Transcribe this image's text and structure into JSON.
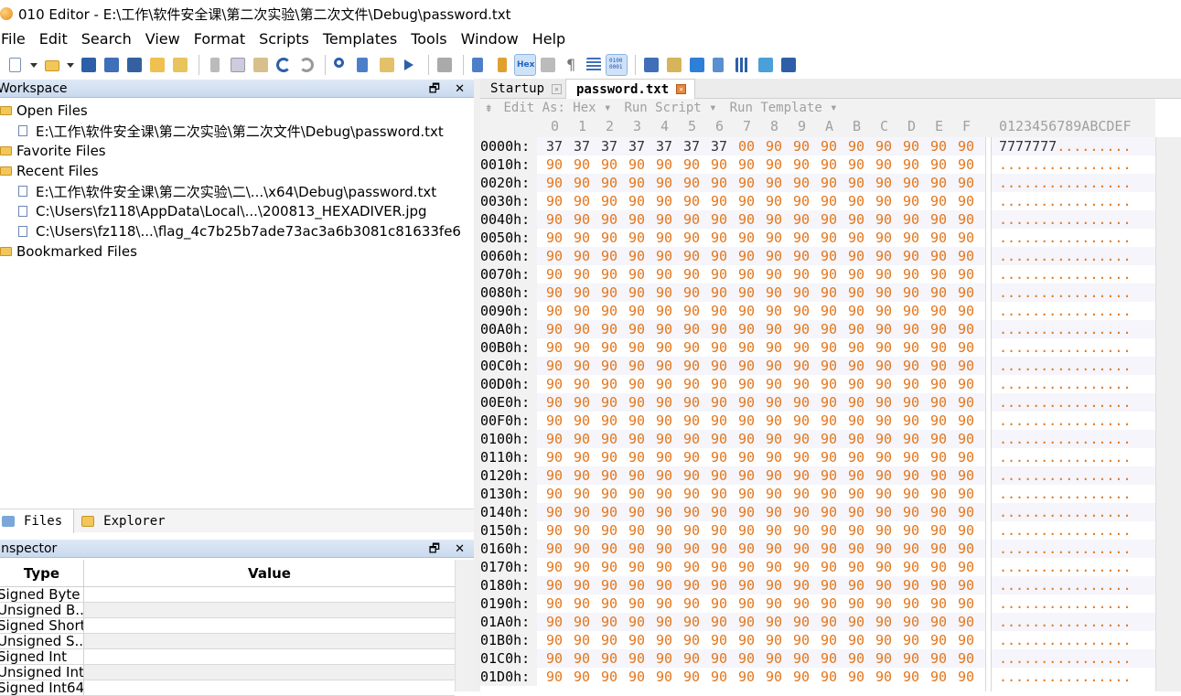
{
  "window": {
    "title": "010 Editor - E:\\工作\\软件安全课\\第二次实验\\第二次文件\\Debug\\password.txt"
  },
  "menu": [
    "File",
    "Edit",
    "Search",
    "View",
    "Format",
    "Scripts",
    "Templates",
    "Tools",
    "Window",
    "Help"
  ],
  "workspace": {
    "title": "Workspace",
    "buttons": "🗗 ✕",
    "open_files_label": "Open Files",
    "open_files": [
      "E:\\工作\\软件安全课\\第二次实验\\第二次文件\\Debug\\password.txt"
    ],
    "favorite_files_label": "Favorite Files",
    "recent_files_label": "Recent Files",
    "recent_files": [
      "E:\\工作\\软件安全课\\第二次实验\\二\\...\\x64\\Debug\\password.txt",
      "C:\\Users\\fz118\\AppData\\Local\\...\\200813_HEXADIVER.jpg",
      "C:\\Users\\fz118\\...\\flag_4c7b25b7ade73ac3a6b3081c81633fe6"
    ],
    "bookmarked_files_label": "Bookmarked Files"
  },
  "bottom_tabs": {
    "files": "Files",
    "explorer": "Explorer"
  },
  "inspector": {
    "title": "Inspector",
    "buttons": "🗗 ✕",
    "col_type": "Type",
    "col_value": "Value",
    "rows": [
      "Signed Byte",
      "Unsigned B...",
      "Signed Short",
      "Unsigned S...",
      "Signed Int",
      "Unsigned Int",
      "Signed Int64"
    ]
  },
  "editor": {
    "tabs": {
      "startup": "Startup",
      "password": "password.txt"
    },
    "hexbar": {
      "edit_as": "Edit As: Hex ▾",
      "run_script": "Run Script ▾",
      "run_template": "Run Template ▾"
    },
    "columns": [
      "0",
      "1",
      "2",
      "3",
      "4",
      "5",
      "6",
      "7",
      "8",
      "9",
      "A",
      "B",
      "C",
      "D",
      "E",
      "F"
    ],
    "ascii_header": "0123456789ABCDEF",
    "rows": [
      {
        "addr": "0000h:",
        "bytes": [
          "37",
          "37",
          "37",
          "37",
          "37",
          "37",
          "37",
          "00",
          "90",
          "90",
          "90",
          "90",
          "90",
          "90",
          "90",
          "90"
        ],
        "ascii": "7777777........."
      },
      {
        "addr": "0010h:",
        "bytes": [
          "90",
          "90",
          "90",
          "90",
          "90",
          "90",
          "90",
          "90",
          "90",
          "90",
          "90",
          "90",
          "90",
          "90",
          "90",
          "90"
        ],
        "ascii": "................"
      },
      {
        "addr": "0020h:",
        "bytes": [
          "90",
          "90",
          "90",
          "90",
          "90",
          "90",
          "90",
          "90",
          "90",
          "90",
          "90",
          "90",
          "90",
          "90",
          "90",
          "90"
        ],
        "ascii": "................"
      },
      {
        "addr": "0030h:",
        "bytes": [
          "90",
          "90",
          "90",
          "90",
          "90",
          "90",
          "90",
          "90",
          "90",
          "90",
          "90",
          "90",
          "90",
          "90",
          "90",
          "90"
        ],
        "ascii": "................"
      },
      {
        "addr": "0040h:",
        "bytes": [
          "90",
          "90",
          "90",
          "90",
          "90",
          "90",
          "90",
          "90",
          "90",
          "90",
          "90",
          "90",
          "90",
          "90",
          "90",
          "90"
        ],
        "ascii": "................"
      },
      {
        "addr": "0050h:",
        "bytes": [
          "90",
          "90",
          "90",
          "90",
          "90",
          "90",
          "90",
          "90",
          "90",
          "90",
          "90",
          "90",
          "90",
          "90",
          "90",
          "90"
        ],
        "ascii": "................"
      },
      {
        "addr": "0060h:",
        "bytes": [
          "90",
          "90",
          "90",
          "90",
          "90",
          "90",
          "90",
          "90",
          "90",
          "90",
          "90",
          "90",
          "90",
          "90",
          "90",
          "90"
        ],
        "ascii": "................"
      },
      {
        "addr": "0070h:",
        "bytes": [
          "90",
          "90",
          "90",
          "90",
          "90",
          "90",
          "90",
          "90",
          "90",
          "90",
          "90",
          "90",
          "90",
          "90",
          "90",
          "90"
        ],
        "ascii": "................"
      },
      {
        "addr": "0080h:",
        "bytes": [
          "90",
          "90",
          "90",
          "90",
          "90",
          "90",
          "90",
          "90",
          "90",
          "90",
          "90",
          "90",
          "90",
          "90",
          "90",
          "90"
        ],
        "ascii": "................"
      },
      {
        "addr": "0090h:",
        "bytes": [
          "90",
          "90",
          "90",
          "90",
          "90",
          "90",
          "90",
          "90",
          "90",
          "90",
          "90",
          "90",
          "90",
          "90",
          "90",
          "90"
        ],
        "ascii": "................"
      },
      {
        "addr": "00A0h:",
        "bytes": [
          "90",
          "90",
          "90",
          "90",
          "90",
          "90",
          "90",
          "90",
          "90",
          "90",
          "90",
          "90",
          "90",
          "90",
          "90",
          "90"
        ],
        "ascii": "................"
      },
      {
        "addr": "00B0h:",
        "bytes": [
          "90",
          "90",
          "90",
          "90",
          "90",
          "90",
          "90",
          "90",
          "90",
          "90",
          "90",
          "90",
          "90",
          "90",
          "90",
          "90"
        ],
        "ascii": "................"
      },
      {
        "addr": "00C0h:",
        "bytes": [
          "90",
          "90",
          "90",
          "90",
          "90",
          "90",
          "90",
          "90",
          "90",
          "90",
          "90",
          "90",
          "90",
          "90",
          "90",
          "90"
        ],
        "ascii": "................"
      },
      {
        "addr": "00D0h:",
        "bytes": [
          "90",
          "90",
          "90",
          "90",
          "90",
          "90",
          "90",
          "90",
          "90",
          "90",
          "90",
          "90",
          "90",
          "90",
          "90",
          "90"
        ],
        "ascii": "................"
      },
      {
        "addr": "00E0h:",
        "bytes": [
          "90",
          "90",
          "90",
          "90",
          "90",
          "90",
          "90",
          "90",
          "90",
          "90",
          "90",
          "90",
          "90",
          "90",
          "90",
          "90"
        ],
        "ascii": "................"
      },
      {
        "addr": "00F0h:",
        "bytes": [
          "90",
          "90",
          "90",
          "90",
          "90",
          "90",
          "90",
          "90",
          "90",
          "90",
          "90",
          "90",
          "90",
          "90",
          "90",
          "90"
        ],
        "ascii": "................"
      },
      {
        "addr": "0100h:",
        "bytes": [
          "90",
          "90",
          "90",
          "90",
          "90",
          "90",
          "90",
          "90",
          "90",
          "90",
          "90",
          "90",
          "90",
          "90",
          "90",
          "90"
        ],
        "ascii": "................"
      },
      {
        "addr": "0110h:",
        "bytes": [
          "90",
          "90",
          "90",
          "90",
          "90",
          "90",
          "90",
          "90",
          "90",
          "90",
          "90",
          "90",
          "90",
          "90",
          "90",
          "90"
        ],
        "ascii": "................"
      },
      {
        "addr": "0120h:",
        "bytes": [
          "90",
          "90",
          "90",
          "90",
          "90",
          "90",
          "90",
          "90",
          "90",
          "90",
          "90",
          "90",
          "90",
          "90",
          "90",
          "90"
        ],
        "ascii": "................"
      },
      {
        "addr": "0130h:",
        "bytes": [
          "90",
          "90",
          "90",
          "90",
          "90",
          "90",
          "90",
          "90",
          "90",
          "90",
          "90",
          "90",
          "90",
          "90",
          "90",
          "90"
        ],
        "ascii": "................"
      },
      {
        "addr": "0140h:",
        "bytes": [
          "90",
          "90",
          "90",
          "90",
          "90",
          "90",
          "90",
          "90",
          "90",
          "90",
          "90",
          "90",
          "90",
          "90",
          "90",
          "90"
        ],
        "ascii": "................"
      },
      {
        "addr": "0150h:",
        "bytes": [
          "90",
          "90",
          "90",
          "90",
          "90",
          "90",
          "90",
          "90",
          "90",
          "90",
          "90",
          "90",
          "90",
          "90",
          "90",
          "90"
        ],
        "ascii": "................"
      },
      {
        "addr": "0160h:",
        "bytes": [
          "90",
          "90",
          "90",
          "90",
          "90",
          "90",
          "90",
          "90",
          "90",
          "90",
          "90",
          "90",
          "90",
          "90",
          "90",
          "90"
        ],
        "ascii": "................"
      },
      {
        "addr": "0170h:",
        "bytes": [
          "90",
          "90",
          "90",
          "90",
          "90",
          "90",
          "90",
          "90",
          "90",
          "90",
          "90",
          "90",
          "90",
          "90",
          "90",
          "90"
        ],
        "ascii": "................"
      },
      {
        "addr": "0180h:",
        "bytes": [
          "90",
          "90",
          "90",
          "90",
          "90",
          "90",
          "90",
          "90",
          "90",
          "90",
          "90",
          "90",
          "90",
          "90",
          "90",
          "90"
        ],
        "ascii": "................"
      },
      {
        "addr": "0190h:",
        "bytes": [
          "90",
          "90",
          "90",
          "90",
          "90",
          "90",
          "90",
          "90",
          "90",
          "90",
          "90",
          "90",
          "90",
          "90",
          "90",
          "90"
        ],
        "ascii": "................"
      },
      {
        "addr": "01A0h:",
        "bytes": [
          "90",
          "90",
          "90",
          "90",
          "90",
          "90",
          "90",
          "90",
          "90",
          "90",
          "90",
          "90",
          "90",
          "90",
          "90",
          "90"
        ],
        "ascii": "................"
      },
      {
        "addr": "01B0h:",
        "bytes": [
          "90",
          "90",
          "90",
          "90",
          "90",
          "90",
          "90",
          "90",
          "90",
          "90",
          "90",
          "90",
          "90",
          "90",
          "90",
          "90"
        ],
        "ascii": "................"
      },
      {
        "addr": "01C0h:",
        "bytes": [
          "90",
          "90",
          "90",
          "90",
          "90",
          "90",
          "90",
          "90",
          "90",
          "90",
          "90",
          "90",
          "90",
          "90",
          "90",
          "90"
        ],
        "ascii": "................"
      },
      {
        "addr": "01D0h:",
        "bytes": [
          "90",
          "90",
          "90",
          "90",
          "90",
          "90",
          "90",
          "90",
          "90",
          "90",
          "90",
          "90",
          "90",
          "90",
          "90",
          "90"
        ],
        "ascii": "................"
      }
    ]
  },
  "colors": {
    "byte_ascii": "#333333",
    "byte_nop": "#e3761c",
    "byte_zero": "#e3761c",
    "header": "#a0a0a0"
  }
}
